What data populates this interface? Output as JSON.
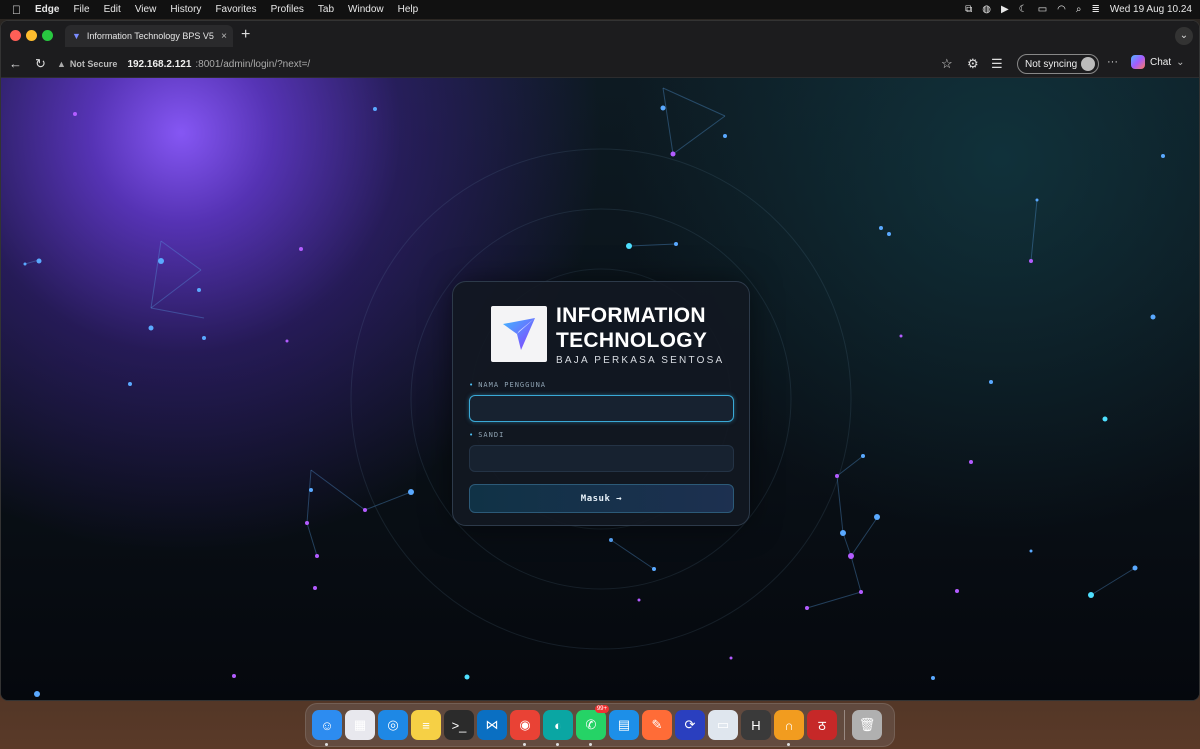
{
  "menubar": {
    "apple": "",
    "app_name": "Edge",
    "menus": [
      "File",
      "Edit",
      "View",
      "History",
      "Favorites",
      "Profiles",
      "Tab",
      "Window",
      "Help"
    ],
    "clock": "Wed 19 Aug  10.24"
  },
  "browser": {
    "tab_title": "Information Technology BPS V5",
    "tab_close": "×",
    "new_tab": "+",
    "address": {
      "warning": "Not Secure",
      "host": "192.168.2.121",
      "path": ":8001/admin/login/?next=/"
    },
    "sync_label": "Not syncing",
    "more_label": "···",
    "chat_label": "Chat"
  },
  "login": {
    "brand_line1": "INFORMATION",
    "brand_line2": "TECHNOLOGY",
    "brand_sub": "BAJA PERKASA SENTOSA",
    "username_label": "NAMA PENGGUNA",
    "password_label": "SANDI",
    "username_value": "",
    "password_value": "",
    "submit_label": "Masuk →"
  },
  "colors": {
    "accent": "#4fc3f7",
    "purple_glow": "#8c5aff",
    "card_bg": "#121822"
  },
  "dock": {
    "items": [
      {
        "name": "finder-icon",
        "glyph": "☺",
        "bg": "#2d8cf0",
        "running": true
      },
      {
        "name": "launchpad-icon",
        "glyph": "▦",
        "bg": "#e8e8ee",
        "running": false
      },
      {
        "name": "safari-icon",
        "glyph": "◎",
        "bg": "#1e88e5",
        "running": false
      },
      {
        "name": "notes-icon",
        "glyph": "≡",
        "bg": "#f6d045",
        "running": false
      },
      {
        "name": "terminal-icon",
        "glyph": ">_",
        "bg": "#2b2b2b",
        "running": false
      },
      {
        "name": "vscode-icon",
        "glyph": "⋈",
        "bg": "#0a6fc2",
        "running": false
      },
      {
        "name": "chrome-icon",
        "glyph": "◉",
        "bg": "#e94235",
        "running": true
      },
      {
        "name": "edge-icon",
        "glyph": "◐",
        "bg": "#0aa6a3",
        "running": true
      },
      {
        "name": "whatsapp-icon",
        "glyph": "✆",
        "bg": "#25d366",
        "running": true,
        "badge": "99+"
      },
      {
        "name": "docker-icon",
        "glyph": "▤",
        "bg": "#1d8fe8",
        "running": false
      },
      {
        "name": "postman-icon",
        "glyph": "✎",
        "bg": "#ff6c37",
        "running": false
      },
      {
        "name": "app-blue-icon",
        "glyph": "⟳",
        "bg": "#2a3fbf",
        "running": false
      },
      {
        "name": "preview-icon",
        "glyph": "▭",
        "bg": "#dfe6ee",
        "running": false
      },
      {
        "name": "h-app-icon",
        "glyph": "H",
        "bg": "#3a3a3a",
        "running": false
      },
      {
        "name": "headphones-app-icon",
        "glyph": "∩",
        "bg": "#f29c1f",
        "running": true
      },
      {
        "name": "red-app-icon",
        "glyph": "ठ",
        "bg": "#c62828",
        "running": false
      },
      {
        "name": "trash-icon",
        "glyph": "🗑",
        "bg": "#b0b0b0",
        "running": false
      }
    ]
  }
}
